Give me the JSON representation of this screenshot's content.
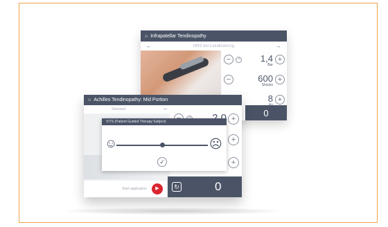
{
  "back_device": {
    "title": "Infrapatellar Tendinopathy",
    "subtitle": "NRS bei Lokalisierung",
    "params": [
      {
        "value": "1,4",
        "unit": "Bar",
        "minus": "−",
        "plus": "+"
      },
      {
        "value": "600",
        "unit": "Shocks",
        "minus": "−",
        "plus": "+"
      },
      {
        "value": "8",
        "unit": "Hz",
        "minus": "−",
        "plus": "+"
      }
    ],
    "counter": "0",
    "nav": {
      "prev": "←",
      "next": "→"
    }
  },
  "front_device": {
    "title": "Achilles Tendinopathy: Mid Portion",
    "subtitle": "Standard",
    "param_value": "2,0",
    "counter": "0",
    "start_label": "Start application",
    "nav": {
      "next": "→"
    },
    "plus": "+",
    "minus": "−"
  },
  "dialog": {
    "title": "VITS (Patient Guided Therapy Subject)",
    "happy_icon": "☺",
    "sad_icon": "☹",
    "confirm_icon": "✓"
  },
  "icons": {
    "home": "⌂",
    "play": "▶",
    "refresh": "↻"
  },
  "colors": {
    "header": "#4b5467",
    "accent_red": "#d9262e",
    "frame_border": "#f0a24a"
  }
}
